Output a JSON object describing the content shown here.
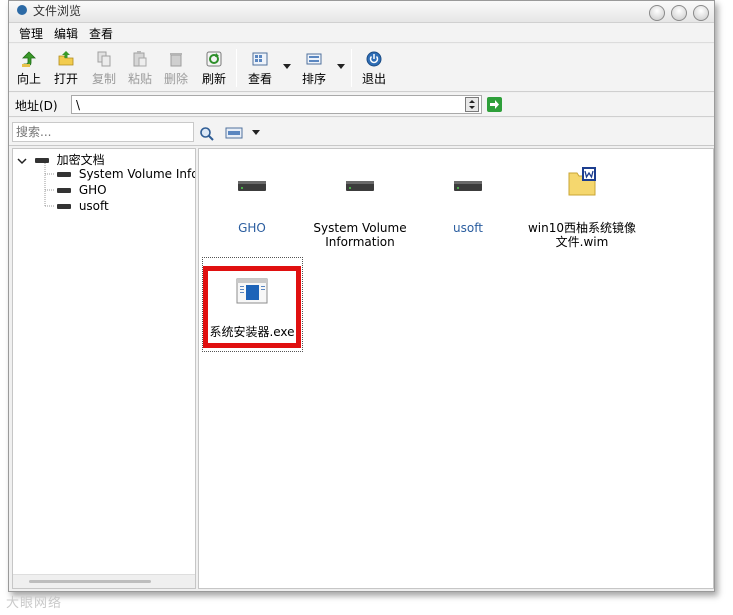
{
  "window": {
    "title": "文件浏览"
  },
  "menu": [
    {
      "label": "管理"
    },
    {
      "label": "编辑"
    },
    {
      "label": "查看"
    }
  ],
  "toolbar": {
    "up": {
      "label": "向上",
      "icon": "up-arrow-icon"
    },
    "open": {
      "label": "打开",
      "icon": "open-folder-icon"
    },
    "copy": {
      "label": "复制",
      "icon": "copy-icon"
    },
    "paste": {
      "label": "粘贴",
      "icon": "paste-icon"
    },
    "delete": {
      "label": "删除",
      "icon": "delete-icon"
    },
    "refresh": {
      "label": "刷新",
      "icon": "refresh-icon"
    },
    "view": {
      "label": "查看",
      "icon": "view-icon"
    },
    "sort": {
      "label": "排序",
      "icon": "sort-icon"
    },
    "exit": {
      "label": "退出",
      "icon": "power-icon"
    }
  },
  "address": {
    "label": "地址(D)",
    "value": "\\"
  },
  "search": {
    "placeholder": "搜索..."
  },
  "tree": {
    "root": {
      "label": "加密文档"
    },
    "children": [
      {
        "label": "System Volume Inforr"
      },
      {
        "label": "GHO"
      },
      {
        "label": "usoft"
      }
    ]
  },
  "files": [
    {
      "name": "GHO",
      "icon": "drive-icon"
    },
    {
      "name": "System Volume Information",
      "icon": "drive-icon"
    },
    {
      "name": "usoft",
      "icon": "drive-icon"
    },
    {
      "name": "win10西柚系统镜像文件.wim",
      "icon": "wim-file-icon"
    },
    {
      "name": "系统安装器.exe",
      "icon": "exe-file-icon"
    }
  ],
  "watermark": "大眼网络",
  "colors": {
    "selection_border": "#e01010",
    "link_text": "#2a5d9f",
    "go_button": "#2e9f3a"
  }
}
